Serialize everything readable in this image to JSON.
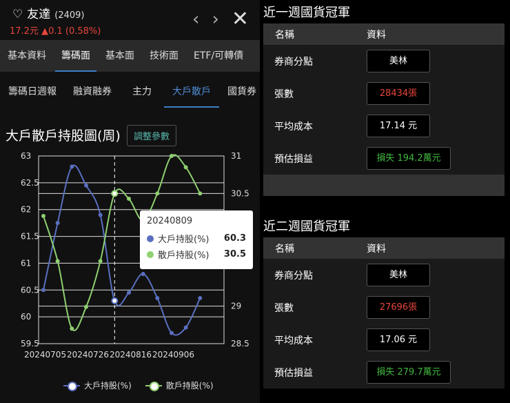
{
  "stock": {
    "heart_icon": "heart-outline-icon",
    "name": "友達",
    "code": "(2409)",
    "price": "17.2元",
    "change": "▲0.1 (0.58%)",
    "colors": {
      "up": "#e8453c"
    }
  },
  "header_icons": [
    "chevron-left-icon",
    "chevron-right-icon",
    "close-icon"
  ],
  "main_tabs": [
    {
      "label": "基本資料"
    },
    {
      "label": "籌碼面"
    },
    {
      "label": "基本面"
    },
    {
      "label": "技術面"
    },
    {
      "label": "ETF/可轉債"
    }
  ],
  "sub_tabs": [
    {
      "label": "籌碼日週報"
    },
    {
      "label": "融資融券"
    },
    {
      "label": "主力"
    },
    {
      "label": "大戶散戶"
    },
    {
      "label": "國貨券"
    }
  ],
  "chart_section": {
    "title": "大戶散戶持股圖(周)",
    "adjust_button": "調整參數"
  },
  "tooltip": {
    "date": "20240809",
    "rows": [
      {
        "label": "大戶持股(%)",
        "value": "60.3",
        "color": "#5a6fc0"
      },
      {
        "label": "散戶持股(%)",
        "value": "30.5",
        "color": "#8fd070"
      }
    ]
  },
  "chart_data": {
    "type": "line",
    "x": [
      "20240705",
      "20240712",
      "20240719",
      "20240726",
      "20240802",
      "20240809",
      "20240816",
      "20240823",
      "20240830",
      "20240906",
      "20240913",
      "20240920"
    ],
    "x_tick_labels": [
      "20240705",
      "20240726",
      "20240816",
      "20240906"
    ],
    "y_left_ticks": [
      "63",
      "62.5",
      "62",
      "61.5",
      "61",
      "60.5",
      "60",
      "59.5"
    ],
    "y_right_ticks": [
      "31",
      "30.5",
      "29",
      "28.5"
    ],
    "ylim_left": [
      59.5,
      63
    ],
    "ylim_right": [
      28.5,
      31
    ],
    "series": [
      {
        "name": "大戶持股(%)",
        "axis": "left",
        "color": "#5a6fc0",
        "values": [
          60.5,
          61.75,
          62.8,
          62.45,
          61.9,
          60.3,
          60.45,
          60.8,
          60.35,
          59.7,
          59.8,
          60.35
        ]
      },
      {
        "name": "散戶持股(%)",
        "axis": "right",
        "color": "#8fd070",
        "values": [
          30.2,
          29.6,
          28.7,
          28.99,
          29.6,
          30.5,
          30.43,
          30.14,
          30.5,
          31.0,
          30.85,
          30.5
        ]
      }
    ],
    "highlight_index": 5,
    "grid": true,
    "legend_position": "bottom"
  },
  "legend": [
    {
      "label": "大戶持股(%)",
      "color": "#5a6fc0"
    },
    {
      "label": "散戶持股(%)",
      "color": "#8fd070"
    }
  ],
  "week1": {
    "title": "近一週國貨冠軍",
    "col_name": "名稱",
    "col_data": "資料",
    "rows": [
      {
        "label": "券商分點",
        "value": "美林",
        "tone": "normal"
      },
      {
        "label": "張數",
        "value": "28434張",
        "tone": "red"
      },
      {
        "label": "平均成本",
        "value": "17.14 元",
        "tone": "normal"
      },
      {
        "label": "預估損益",
        "value": "損失 194.2萬元",
        "tone": "green"
      }
    ]
  },
  "week2": {
    "title": "近二週國貨冠軍",
    "col_name": "名稱",
    "col_data": "資料",
    "rows": [
      {
        "label": "券商分點",
        "value": "美林",
        "tone": "normal"
      },
      {
        "label": "張數",
        "value": "27696張",
        "tone": "red"
      },
      {
        "label": "平均成本",
        "value": "17.06 元",
        "tone": "normal"
      },
      {
        "label": "預估損益",
        "value": "損失 279.7萬元",
        "tone": "green"
      }
    ]
  }
}
